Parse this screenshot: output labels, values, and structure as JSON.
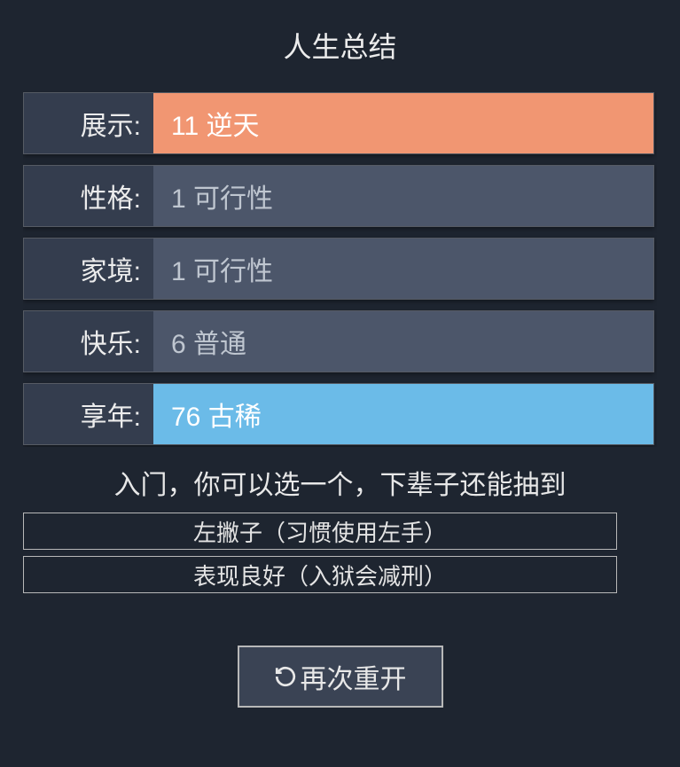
{
  "page_title": "人生总结",
  "stats": [
    {
      "label": "展示:",
      "value": "11 逆天",
      "color": "orange"
    },
    {
      "label": "性格:",
      "value": "1 可行性",
      "color": "gray"
    },
    {
      "label": "家境:",
      "value": "1 可行性",
      "color": "gray"
    },
    {
      "label": "快乐:",
      "value": "6 普通",
      "color": "gray"
    },
    {
      "label": "享年:",
      "value": "76 古稀",
      "color": "blue"
    }
  ],
  "talent_prompt": "入门，你可以选一个，下辈子还能抽到",
  "talents": [
    {
      "text": "左撇子（习惯使用左手）"
    },
    {
      "text": "表现良好（入狱会减刑）"
    }
  ],
  "restart_label": "再次重开"
}
